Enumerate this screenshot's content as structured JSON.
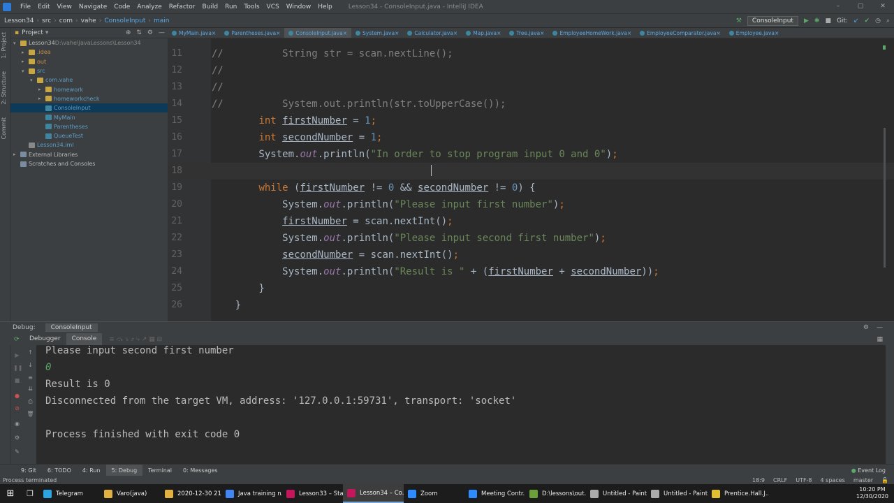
{
  "menubar": {
    "items": [
      "File",
      "Edit",
      "View",
      "Navigate",
      "Code",
      "Analyze",
      "Refactor",
      "Build",
      "Run",
      "Tools",
      "VCS",
      "Window",
      "Help"
    ],
    "title": "Lesson34 - ConsoleInput.java - IntelliJ IDEA"
  },
  "navbar": {
    "crumbs": [
      "Lesson34",
      "src",
      "com",
      "vahe",
      "ConsoleInput",
      "main"
    ],
    "run_config": "ConsoleInput",
    "git_label": "Git:"
  },
  "left_strip": {
    "project": "1: Project",
    "structure": "2: Structure",
    "commit": "Commit"
  },
  "project": {
    "title": "Project",
    "tree": [
      {
        "label": "Lesson34",
        "extra": "D:\\vahe\\JavaLessons\\Lesson34",
        "indent": 1,
        "arrow": "▾",
        "type": "folder",
        "color": "normal"
      },
      {
        "label": ".idea",
        "indent": 2,
        "arrow": "▸",
        "type": "folder",
        "color": "orange"
      },
      {
        "label": "out",
        "indent": 2,
        "arrow": "▸",
        "type": "folder",
        "color": "orange"
      },
      {
        "label": "src",
        "indent": 2,
        "arrow": "▾",
        "type": "folder",
        "color": "blue"
      },
      {
        "label": "com.vahe",
        "indent": 3,
        "arrow": "▾",
        "type": "folder",
        "color": "blue"
      },
      {
        "label": "homework",
        "indent": 4,
        "arrow": "▸",
        "type": "folder",
        "color": "blue"
      },
      {
        "label": "homeworkcheck",
        "indent": 4,
        "arrow": "▸",
        "type": "folder",
        "color": "blue"
      },
      {
        "label": "ConsoleInput",
        "indent": 4,
        "arrow": "",
        "type": "java",
        "color": "blue",
        "selected": true
      },
      {
        "label": "MyMain",
        "indent": 4,
        "arrow": "",
        "type": "java",
        "color": "blue"
      },
      {
        "label": "Parentheses",
        "indent": 4,
        "arrow": "",
        "type": "java",
        "color": "blue"
      },
      {
        "label": "QueueTest",
        "indent": 4,
        "arrow": "",
        "type": "java",
        "color": "blue"
      },
      {
        "label": "Lesson34.iml",
        "indent": 2,
        "arrow": "",
        "type": "file",
        "color": "blue"
      },
      {
        "label": "External Libraries",
        "indent": 1,
        "arrow": "▸",
        "type": "lib",
        "color": "normal"
      },
      {
        "label": "Scratches and Consoles",
        "indent": 1,
        "arrow": "",
        "type": "lib",
        "color": "normal"
      }
    ]
  },
  "tabs": [
    "MyMain.java",
    "Parentheses.java",
    "ConsoleInput.java",
    "System.java",
    "Calculator.java",
    "Map.java",
    "Tree.java",
    "EmployeeHomeWork.java",
    "EmployeeComparator.java",
    "Employee.java"
  ],
  "active_tab": 2,
  "editor": {
    "lines": [
      {
        "n": "11",
        "tokens": [
          [
            "cmt",
            "//          String str = scan.nextLine();"
          ]
        ]
      },
      {
        "n": "12",
        "tokens": [
          [
            "cmt",
            "//"
          ]
        ]
      },
      {
        "n": "13",
        "tokens": [
          [
            "cmt",
            "//"
          ]
        ]
      },
      {
        "n": "14",
        "tokens": [
          [
            "cmt",
            "//          System.out.println(str.toUpperCase());"
          ]
        ]
      },
      {
        "n": "15",
        "tokens": [
          [
            "",
            "        "
          ],
          [
            "kw",
            "int "
          ],
          [
            "var",
            "firstNumber"
          ],
          [
            "",
            " = "
          ],
          [
            "num",
            "1"
          ],
          [
            "kw",
            ";"
          ]
        ]
      },
      {
        "n": "16",
        "tokens": [
          [
            "",
            "        "
          ],
          [
            "kw",
            "int "
          ],
          [
            "var",
            "secondNumber"
          ],
          [
            "",
            " = "
          ],
          [
            "num",
            "1"
          ],
          [
            "kw",
            ";"
          ]
        ]
      },
      {
        "n": "17",
        "tokens": [
          [
            "",
            "        System."
          ],
          [
            "fld",
            "out"
          ],
          [
            "",
            ".println("
          ],
          [
            "str",
            "\"In order to stop program input 0 and 0\""
          ],
          [
            "",
            ")"
          ],
          [
            "kw",
            ";"
          ]
        ]
      },
      {
        "n": "18",
        "tokens": [
          [
            "",
            ""
          ]
        ],
        "current": true
      },
      {
        "n": "19",
        "tokens": [
          [
            "",
            "        "
          ],
          [
            "kw",
            "while "
          ],
          [
            "",
            "("
          ],
          [
            "var",
            "firstNumber"
          ],
          [
            "",
            " != "
          ],
          [
            "num",
            "0"
          ],
          [
            "",
            " && "
          ],
          [
            "var",
            "secondNumber"
          ],
          [
            "",
            " != "
          ],
          [
            "num",
            "0"
          ],
          [
            "",
            ") {"
          ]
        ]
      },
      {
        "n": "20",
        "tokens": [
          [
            "",
            "            System."
          ],
          [
            "fld",
            "out"
          ],
          [
            "",
            ".println("
          ],
          [
            "str",
            "\"Please input first number\""
          ],
          [
            "",
            ")"
          ],
          [
            "kw",
            ";"
          ]
        ]
      },
      {
        "n": "21",
        "tokens": [
          [
            "",
            "            "
          ],
          [
            "var",
            "firstNumber"
          ],
          [
            "",
            " = scan.nextInt()"
          ],
          [
            "kw",
            ";"
          ]
        ]
      },
      {
        "n": "22",
        "tokens": [
          [
            "",
            "            System."
          ],
          [
            "fld",
            "out"
          ],
          [
            "",
            ".println("
          ],
          [
            "str",
            "\"Please input second first number\""
          ],
          [
            "",
            ")"
          ],
          [
            "kw",
            ";"
          ]
        ]
      },
      {
        "n": "23",
        "tokens": [
          [
            "",
            "            "
          ],
          [
            "var",
            "secondNumber"
          ],
          [
            "",
            " = scan.nextInt()"
          ],
          [
            "kw",
            ";"
          ]
        ]
      },
      {
        "n": "24",
        "tokens": [
          [
            "",
            "            System."
          ],
          [
            "fld",
            "out"
          ],
          [
            "",
            ".println("
          ],
          [
            "str",
            "\"Result is \""
          ],
          [
            "",
            " + ("
          ],
          [
            "var",
            "firstNumber"
          ],
          [
            "",
            " + "
          ],
          [
            "var",
            "secondNumber"
          ],
          [
            "",
            "))"
          ],
          [
            "kw",
            ";"
          ]
        ]
      },
      {
        "n": "25",
        "tokens": [
          [
            "",
            "        }"
          ]
        ]
      },
      {
        "n": "26",
        "tokens": [
          [
            "",
            "    }"
          ]
        ]
      }
    ]
  },
  "debug": {
    "label": "Debug:",
    "session": "ConsoleInput",
    "subtabs": [
      "Debugger",
      "Console"
    ]
  },
  "console": {
    "lines": [
      {
        "text": "Please input second first number",
        "kind": "out"
      },
      {
        "text": "0",
        "kind": "in"
      },
      {
        "text": "Result is 0",
        "kind": "out"
      },
      {
        "text": "Disconnected from the target VM, address: '127.0.0.1:59731', transport: 'socket'",
        "kind": "out"
      },
      {
        "text": "",
        "kind": "out"
      },
      {
        "text": "Process finished with exit code 0",
        "kind": "out"
      }
    ]
  },
  "bottom_tabs": [
    "9: Git",
    "6: TODO",
    "4: Run",
    "5: Debug",
    "Terminal",
    "0: Messages"
  ],
  "active_bottom": 3,
  "event_log": "Event Log",
  "status": {
    "left": "Process terminated",
    "position": "18:9",
    "line_sep": "CRLF",
    "encoding": "UTF-8",
    "indent": "4 spaces",
    "branch": "master"
  },
  "taskbar": {
    "items": [
      {
        "label": "Telegram",
        "color": "#2ca5e0"
      },
      {
        "label": "Varo(java)",
        "color": "#e0b040"
      },
      {
        "label": "2020-12-30 21...",
        "color": "#e0b040"
      },
      {
        "label": "Java training n...",
        "color": "#4285f4"
      },
      {
        "label": "Lesson33 – Sta...",
        "color": "#c2185b"
      },
      {
        "label": "Lesson34 – Co...",
        "color": "#c2185b",
        "active": true
      },
      {
        "label": "Zoom",
        "color": "#2d8cff"
      },
      {
        "label": "Meeting Contr...",
        "color": "#2d8cff"
      },
      {
        "label": "D:\\lessons\\out...",
        "color": "#6a9f3a"
      },
      {
        "label": "Untitled - Paint",
        "color": "#aaaaaa"
      },
      {
        "label": "Untitled - Paint",
        "color": "#aaaaaa"
      },
      {
        "label": "Prentice.Hall.J...",
        "color": "#e0c030"
      }
    ],
    "time": "10:20 PM",
    "date": "12/30/2020"
  }
}
